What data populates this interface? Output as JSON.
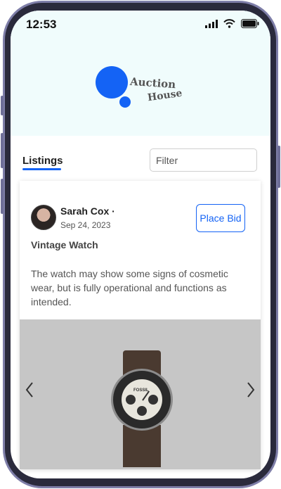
{
  "status": {
    "time": "12:53"
  },
  "logo": {
    "line1": "Auction",
    "line2": "House"
  },
  "tabs": {
    "listings": "Listings"
  },
  "filter": {
    "placeholder": "Filter"
  },
  "listing": {
    "seller": "Sarah Cox",
    "seller_suffix": "·",
    "date": "Sep 24, 2023",
    "bid_label": "Place Bid",
    "title": "Vintage Watch",
    "description": "The watch may show some signs of cosmetic wear, but is fully operational and functions as intended.",
    "image_text": "FOSSIL"
  },
  "colors": {
    "accent": "#1463f5",
    "header_bg": "#f0fcfc"
  }
}
